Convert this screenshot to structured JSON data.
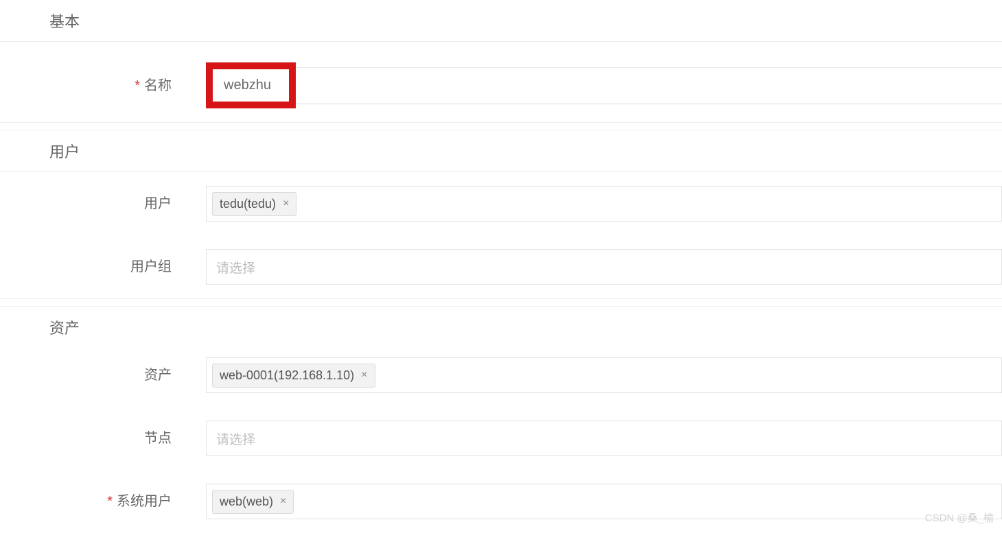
{
  "sections": {
    "basic": {
      "heading": "基本"
    },
    "user": {
      "heading": "用户"
    },
    "asset": {
      "heading": "资产"
    }
  },
  "fields": {
    "name": {
      "label": "名称",
      "value": "webzhu",
      "required": true
    },
    "user": {
      "label": "用户",
      "tag": "tedu(tedu)"
    },
    "usergroup": {
      "label": "用户组",
      "placeholder": "请选择"
    },
    "asset": {
      "label": "资产",
      "tag": "web-0001(192.168.1.10)"
    },
    "node": {
      "label": "节点",
      "placeholder": "请选择"
    },
    "systemuser": {
      "label": "系统用户",
      "tag": "web(web)",
      "required": true
    }
  },
  "watermark": "CSDN @桑_榆"
}
